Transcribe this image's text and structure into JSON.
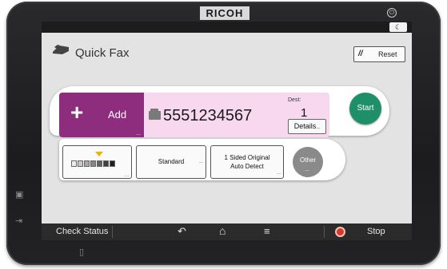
{
  "device": {
    "brand": "RICOH"
  },
  "title": "Quick Fax",
  "reset_label": "Reset",
  "add_label": "Add",
  "destination": {
    "number": "5551234567",
    "dest_label": "Dest:",
    "count": "1",
    "details_label": "Details"
  },
  "start_label": "Start",
  "options": {
    "density_level_index": 3,
    "density_steps": 7,
    "resolution": "Standard",
    "original_line1": "1 Sided Original",
    "original_line2": "Auto Detect",
    "other": "Other"
  },
  "bottom": {
    "check_status": "Check Status",
    "stop": "Stop"
  },
  "colors": {
    "accent_add": "#8e2c7d",
    "dest_bg": "#f8d8ef",
    "start": "#1f8f6a",
    "density_arrow": "#e6b800"
  }
}
